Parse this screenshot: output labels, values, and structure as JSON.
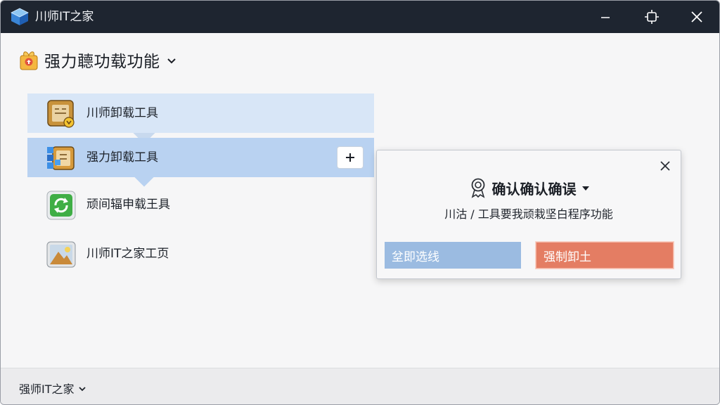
{
  "window": {
    "title": "川师IT之家",
    "controls": [
      "minimize-icon",
      "restore-icon",
      "close-icon"
    ]
  },
  "header": {
    "icon": "gift-box-icon",
    "title": "强力聼功载功能"
  },
  "list": {
    "items": [
      {
        "label": "川师卸载工具",
        "icon": "uninstall-box-icon"
      },
      {
        "label": "强力卸载工具",
        "icon": "force-uninstall-icon",
        "action": "+"
      },
      {
        "label": "顽间辐申载王具",
        "icon": "refresh-green-icon"
      },
      {
        "label": "川师IT之家工页",
        "icon": "landscape-picture-icon"
      }
    ]
  },
  "popup": {
    "icon": "award-badge-icon",
    "title": "确认确认确误",
    "message": "川沽 / 工具要我顽栽坚白程序功能",
    "cancel_label": "坌即选线",
    "confirm_label": "强制卸土"
  },
  "footer": {
    "label": "强师IT之家"
  },
  "colors": {
    "titlebar": "#1e2530",
    "selected_row": "#b9d2f1",
    "hover_row": "#d8e6f7",
    "cancel_button": "#9bbbe1",
    "confirm_button": "#e47d63"
  }
}
